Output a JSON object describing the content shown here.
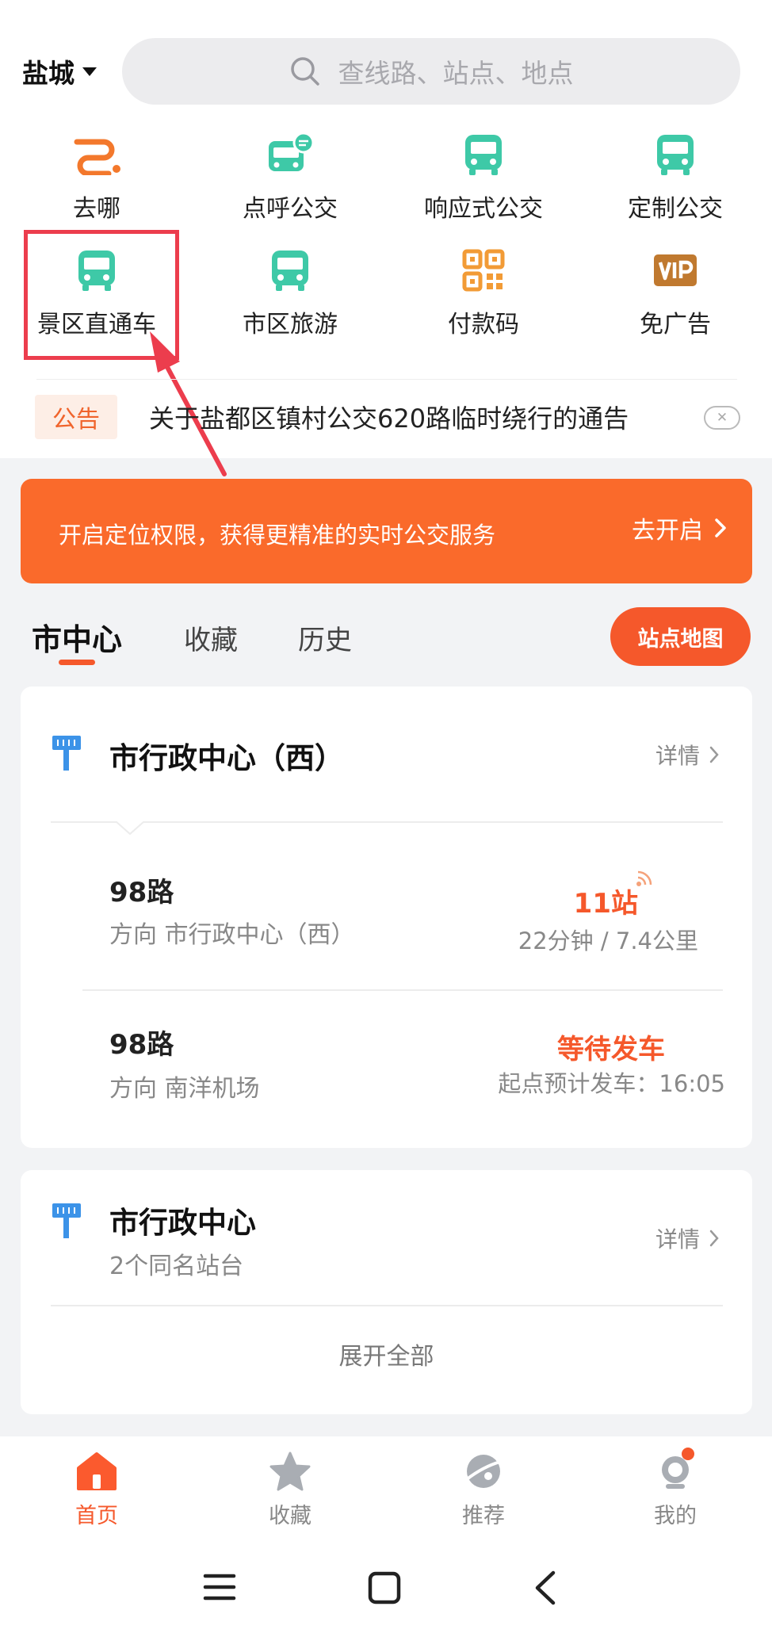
{
  "header": {
    "city": "盐城",
    "search_placeholder": "查线路、站点、地点"
  },
  "quick_access": [
    {
      "label": "去哪",
      "icon": "route-icon"
    },
    {
      "label": "点呼公交",
      "icon": "bus-call-icon"
    },
    {
      "label": "响应式公交",
      "icon": "bus-icon"
    },
    {
      "label": "定制公交",
      "icon": "bus-icon"
    },
    {
      "label": "景区直通车",
      "icon": "bus-icon"
    },
    {
      "label": "市区旅游",
      "icon": "bus-icon"
    },
    {
      "label": "付款码",
      "icon": "qr-code-icon"
    },
    {
      "label": "免广告",
      "icon": "vip-icon"
    }
  ],
  "notice": {
    "tag": "公告",
    "text": "关于盐都区镇村公交620路临时绕行的通告"
  },
  "location_banner": {
    "text": "开启定位权限，获得更精准的实时公交服务",
    "button": "去开启"
  },
  "tabs": {
    "items": [
      "市中心",
      "收藏",
      "历史"
    ],
    "active": "市中心",
    "map_button": "站点地图"
  },
  "stop_card_1": {
    "name": "市行政中心（西）",
    "detail": "详情",
    "routes": [
      {
        "route": "98路",
        "direction": "方向 市行政中心（西）",
        "eta": "11站",
        "eta_sub": "22分钟 / 7.4公里"
      },
      {
        "route": "98路",
        "direction": "方向 南洋机场",
        "eta": "等待发车",
        "eta_sub": "起点预计发车：16:05"
      }
    ]
  },
  "stop_card_2": {
    "name": "市行政中心",
    "sub": "2个同名站台",
    "detail": "详情",
    "expand": "展开全部"
  },
  "bottom_nav": [
    {
      "label": "首页",
      "icon": "home-icon",
      "active": true
    },
    {
      "label": "收藏",
      "icon": "star-icon",
      "active": false
    },
    {
      "label": "推荐",
      "icon": "planet-icon",
      "active": false
    },
    {
      "label": "我的",
      "icon": "profile-icon",
      "active": false
    }
  ],
  "colors": {
    "accent": "#f5582b",
    "bus_green": "#3ec9a7",
    "qr_orange": "#f29b36",
    "vip_brown": "#c0792f",
    "highlight_red": "#ec3d4d"
  }
}
